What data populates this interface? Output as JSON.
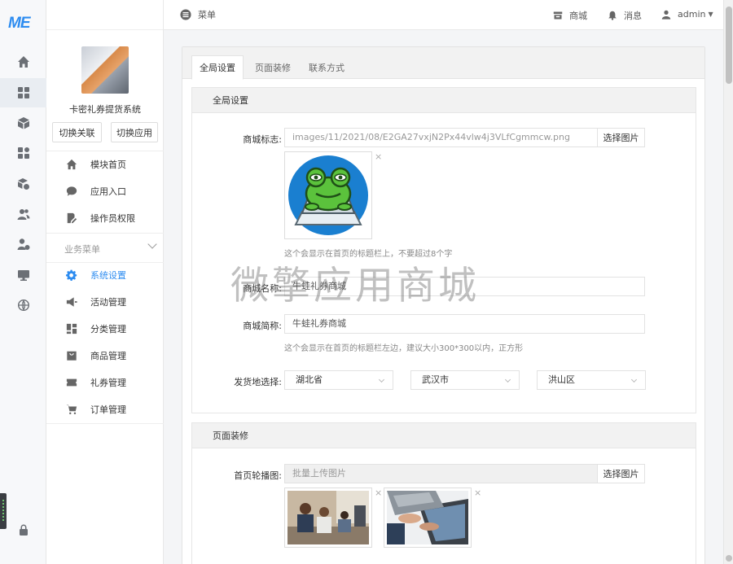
{
  "rail": {
    "logo": "ME",
    "icons": [
      "home-icon",
      "grid-icon",
      "cube-icon",
      "apps-icon",
      "box-settings-icon",
      "users-icon",
      "user-settings-icon",
      "monitor-icon",
      "globe-icon"
    ],
    "bottom_icon": "lock-icon"
  },
  "sidebar": {
    "app_name": "卡密礼券提货系统",
    "buttons": {
      "switch_link": "切换关联",
      "switch_app": "切换应用"
    },
    "top_items": [
      {
        "label": "模块首页",
        "icon": "home-icon"
      },
      {
        "label": "应用入口",
        "icon": "chat-icon"
      },
      {
        "label": "操作员权限",
        "icon": "edit-doc-icon"
      }
    ],
    "group_label": "业务菜单",
    "biz_items": [
      {
        "label": "系统设置",
        "icon": "gear-icon",
        "active": true
      },
      {
        "label": "活动管理",
        "icon": "megaphone-icon"
      },
      {
        "label": "分类管理",
        "icon": "category-icon"
      },
      {
        "label": "商品管理",
        "icon": "bag-icon"
      },
      {
        "label": "礼券管理",
        "icon": "ticket-icon"
      },
      {
        "label": "订单管理",
        "icon": "cart-icon"
      }
    ]
  },
  "topbar": {
    "menu_label": "菜单",
    "shop_label": "商城",
    "message_label": "消息",
    "user_label": "admin"
  },
  "tabs": [
    {
      "label": "全局设置",
      "active": true
    },
    {
      "label": "页面装修"
    },
    {
      "label": "联系方式"
    }
  ],
  "global": {
    "section_title": "全局设置",
    "logo_label": "商城标志:",
    "logo_value": "images/11/2021/08/E2GA27vxjN2Px44vlw4j3VLfCgmmcw.png",
    "pick_image": "选择图片",
    "logo_hint": "这个会显示在首页的标题栏上，不要超过8个字",
    "name_label": "商城名称:",
    "name_value": "牛蛙礼券商城",
    "short_label": "商城简称:",
    "short_value": "牛蛙礼券商城",
    "short_hint": "这个会显示在首页的标题栏左边，建议大小300*300以内，正方形",
    "ship_label": "发货地选择:",
    "province": "湖北省",
    "city": "武汉市",
    "district": "洪山区"
  },
  "decor": {
    "section_title": "页面装修",
    "banner_label": "首页轮播图:",
    "banner_placeholder": "批量上传图片",
    "pick_image": "选择图片"
  },
  "watermark": "微擎应用商城",
  "colors": {
    "accent": "#2d8cf0",
    "frog_bg": "#1a7fd0",
    "frog_green": "#5bc23c"
  }
}
